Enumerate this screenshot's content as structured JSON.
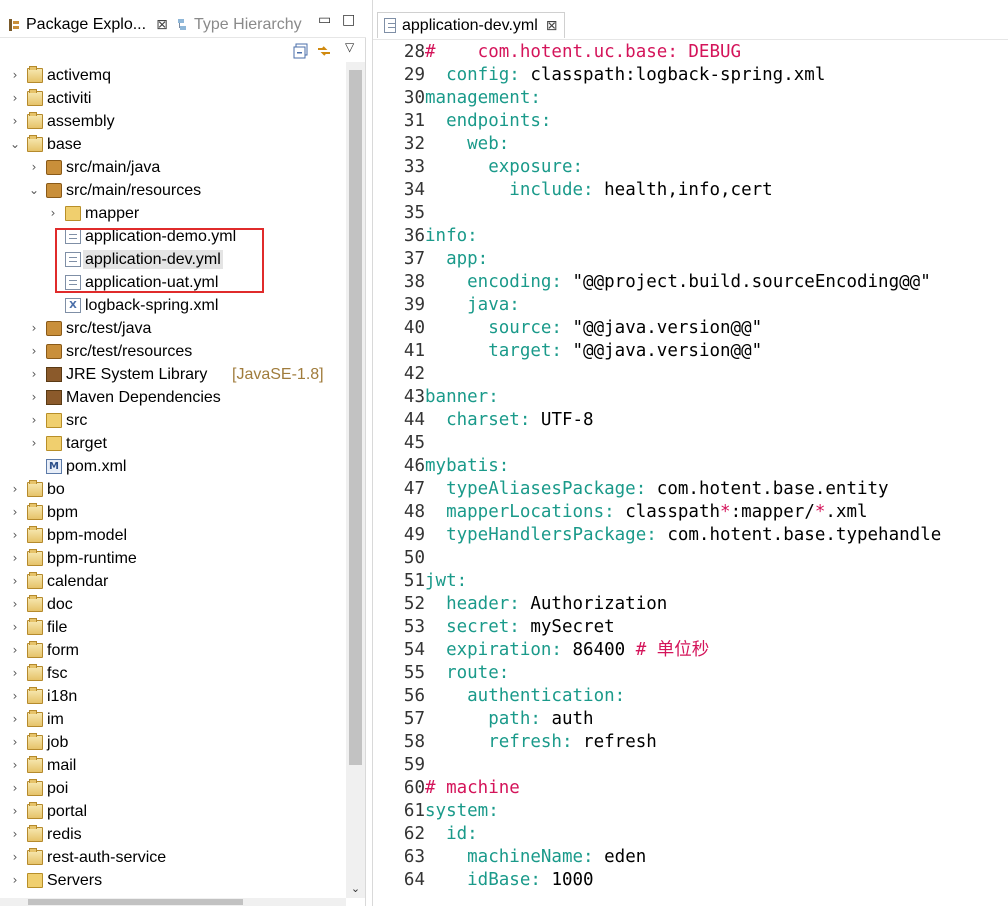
{
  "left_panel": {
    "tabs": [
      {
        "label": "Package Explo...",
        "active": true
      },
      {
        "label": "Type Hierarchy",
        "active": false
      }
    ],
    "close_glyph": "⊠",
    "minimize_glyph": "▭",
    "maximize_glyph": "□",
    "view_menu_glyph": "▽",
    "tree": [
      {
        "label": "activemq",
        "icon": "project-icon",
        "depth": 0,
        "chevron": "›"
      },
      {
        "label": "activiti",
        "icon": "project-icon",
        "depth": 0,
        "chevron": "›"
      },
      {
        "label": "assembly",
        "icon": "project-icon",
        "depth": 0,
        "chevron": "›"
      },
      {
        "label": "base",
        "icon": "project-icon",
        "depth": 0,
        "chevron": "⌄"
      },
      {
        "label": "src/main/java",
        "icon": "package-folder-icon",
        "depth": 1,
        "chevron": "›"
      },
      {
        "label": "src/main/resources",
        "icon": "package-folder-icon",
        "depth": 1,
        "chevron": "⌄"
      },
      {
        "label": "mapper",
        "icon": "folder-icon",
        "depth": 2,
        "chevron": "›"
      },
      {
        "label": "application-demo.yml",
        "icon": "file-icon",
        "depth": 2,
        "chevron": ""
      },
      {
        "label": "application-dev.yml",
        "icon": "file-icon",
        "depth": 2,
        "chevron": "",
        "selected": true
      },
      {
        "label": "application-uat.yml",
        "icon": "file-icon",
        "depth": 2,
        "chevron": ""
      },
      {
        "label": "logback-spring.xml",
        "icon": "xml-file-icon",
        "depth": 2,
        "chevron": ""
      },
      {
        "label": "src/test/java",
        "icon": "package-folder-icon",
        "depth": 1,
        "chevron": "›"
      },
      {
        "label": "src/test/resources",
        "icon": "package-folder-icon",
        "depth": 1,
        "chevron": "›"
      },
      {
        "label": "JRE System Library",
        "decoration": "[JavaSE-1.8]",
        "icon": "library-icon",
        "depth": 1,
        "chevron": "›"
      },
      {
        "label": "Maven Dependencies",
        "icon": "library-icon",
        "depth": 1,
        "chevron": "›"
      },
      {
        "label": "src",
        "icon": "folder-icon",
        "depth": 1,
        "chevron": "›"
      },
      {
        "label": "target",
        "icon": "folder-icon",
        "depth": 1,
        "chevron": "›"
      },
      {
        "label": "pom.xml",
        "icon": "pom-file-icon",
        "depth": 1,
        "chevron": ""
      },
      {
        "label": "bo",
        "icon": "project-icon",
        "depth": 0,
        "chevron": "›"
      },
      {
        "label": "bpm",
        "icon": "project-icon",
        "depth": 0,
        "chevron": "›"
      },
      {
        "label": "bpm-model",
        "icon": "project-icon",
        "depth": 0,
        "chevron": "›"
      },
      {
        "label": "bpm-runtime",
        "icon": "project-icon",
        "depth": 0,
        "chevron": "›"
      },
      {
        "label": "calendar",
        "icon": "project-icon",
        "depth": 0,
        "chevron": "›"
      },
      {
        "label": "doc",
        "icon": "project-icon",
        "depth": 0,
        "chevron": "›"
      },
      {
        "label": "file",
        "icon": "project-icon",
        "depth": 0,
        "chevron": "›"
      },
      {
        "label": "form",
        "icon": "project-icon",
        "depth": 0,
        "chevron": "›"
      },
      {
        "label": "fsc",
        "icon": "project-icon",
        "depth": 0,
        "chevron": "›"
      },
      {
        "label": "i18n",
        "icon": "project-icon",
        "depth": 0,
        "chevron": "›"
      },
      {
        "label": "im",
        "icon": "project-icon",
        "depth": 0,
        "chevron": "›"
      },
      {
        "label": "job",
        "icon": "project-icon",
        "depth": 0,
        "chevron": "›"
      },
      {
        "label": "mail",
        "icon": "project-icon",
        "depth": 0,
        "chevron": "›"
      },
      {
        "label": "poi",
        "icon": "project-icon",
        "depth": 0,
        "chevron": "›"
      },
      {
        "label": "portal",
        "icon": "project-icon",
        "depth": 0,
        "chevron": "›"
      },
      {
        "label": "redis",
        "icon": "project-icon",
        "depth": 0,
        "chevron": "›"
      },
      {
        "label": "rest-auth-service",
        "icon": "project-icon",
        "depth": 0,
        "chevron": "›"
      },
      {
        "label": "Servers",
        "icon": "folder-icon",
        "depth": 0,
        "chevron": "›"
      }
    ]
  },
  "editor": {
    "tab": {
      "label": "application-dev.yml",
      "close_glyph": "⊠"
    },
    "lines": [
      {
        "n": "28",
        "segs": [
          {
            "t": "#    com.hotent.uc.base: DEBUG",
            "c": "c"
          }
        ]
      },
      {
        "n": "29",
        "segs": [
          {
            "t": "  config: ",
            "c": "k"
          },
          {
            "t": "classpath:logback-spring.xml",
            "c": "v"
          }
        ]
      },
      {
        "n": "30",
        "segs": [
          {
            "t": "management:",
            "c": "k"
          }
        ]
      },
      {
        "n": "31",
        "segs": [
          {
            "t": "  endpoints:",
            "c": "k"
          }
        ]
      },
      {
        "n": "32",
        "segs": [
          {
            "t": "    web:",
            "c": "k"
          }
        ]
      },
      {
        "n": "33",
        "segs": [
          {
            "t": "      exposure:",
            "c": "k"
          }
        ]
      },
      {
        "n": "34",
        "segs": [
          {
            "t": "        include: ",
            "c": "k"
          },
          {
            "t": "health,info,cert",
            "c": "v"
          }
        ]
      },
      {
        "n": "35",
        "segs": []
      },
      {
        "n": "36",
        "segs": [
          {
            "t": "info:",
            "c": "k"
          }
        ]
      },
      {
        "n": "37",
        "segs": [
          {
            "t": "  app:",
            "c": "k"
          }
        ]
      },
      {
        "n": "38",
        "segs": [
          {
            "t": "    encoding: ",
            "c": "k"
          },
          {
            "t": "\"@@project.build.sourceEncoding@@\"",
            "c": "v"
          }
        ]
      },
      {
        "n": "39",
        "segs": [
          {
            "t": "    java:",
            "c": "k"
          }
        ]
      },
      {
        "n": "40",
        "segs": [
          {
            "t": "      source: ",
            "c": "k"
          },
          {
            "t": "\"@@java.version@@\"",
            "c": "v"
          }
        ]
      },
      {
        "n": "41",
        "segs": [
          {
            "t": "      target: ",
            "c": "k"
          },
          {
            "t": "\"@@java.version@@\"",
            "c": "v"
          }
        ]
      },
      {
        "n": "42",
        "segs": []
      },
      {
        "n": "43",
        "segs": [
          {
            "t": "banner:",
            "c": "k"
          }
        ]
      },
      {
        "n": "44",
        "segs": [
          {
            "t": "  charset: ",
            "c": "k"
          },
          {
            "t": "UTF-8",
            "c": "v"
          }
        ]
      },
      {
        "n": "45",
        "segs": []
      },
      {
        "n": "46",
        "segs": [
          {
            "t": "mybatis:",
            "c": "k"
          }
        ]
      },
      {
        "n": "47",
        "segs": [
          {
            "t": "  typeAliasesPackage: ",
            "c": "k"
          },
          {
            "t": "com.hotent.base.entity",
            "c": "v"
          }
        ]
      },
      {
        "n": "48",
        "segs": [
          {
            "t": "  mapperLocations: ",
            "c": "k"
          },
          {
            "t": "classpath",
            "c": "v"
          },
          {
            "t": "*",
            "c": "p"
          },
          {
            "t": ":mapper/",
            "c": "v"
          },
          {
            "t": "*",
            "c": "p"
          },
          {
            "t": ".xml",
            "c": "v"
          }
        ]
      },
      {
        "n": "49",
        "segs": [
          {
            "t": "  typeHandlersPackage: ",
            "c": "k"
          },
          {
            "t": "com.hotent.base.typehandle",
            "c": "v"
          }
        ]
      },
      {
        "n": "50",
        "segs": []
      },
      {
        "n": "51",
        "segs": [
          {
            "t": "jwt:",
            "c": "k"
          }
        ]
      },
      {
        "n": "52",
        "segs": [
          {
            "t": "  header: ",
            "c": "k"
          },
          {
            "t": "Authorization",
            "c": "v"
          }
        ]
      },
      {
        "n": "53",
        "segs": [
          {
            "t": "  secret: ",
            "c": "k"
          },
          {
            "t": "mySecret",
            "c": "v"
          }
        ]
      },
      {
        "n": "54",
        "segs": [
          {
            "t": "  expiration: ",
            "c": "k"
          },
          {
            "t": "86400 ",
            "c": "v"
          },
          {
            "t": "# 单位秒",
            "c": "c"
          }
        ]
      },
      {
        "n": "55",
        "segs": [
          {
            "t": "  route:",
            "c": "k"
          }
        ]
      },
      {
        "n": "56",
        "segs": [
          {
            "t": "    authentication:",
            "c": "k"
          }
        ]
      },
      {
        "n": "57",
        "segs": [
          {
            "t": "      path: ",
            "c": "k"
          },
          {
            "t": "auth",
            "c": "v"
          }
        ]
      },
      {
        "n": "58",
        "segs": [
          {
            "t": "      refresh: ",
            "c": "k"
          },
          {
            "t": "refresh",
            "c": "v"
          }
        ]
      },
      {
        "n": "59",
        "segs": []
      },
      {
        "n": "60",
        "segs": [
          {
            "t": "# machine",
            "c": "c"
          }
        ]
      },
      {
        "n": "61",
        "segs": [
          {
            "t": "system:",
            "c": "k"
          }
        ]
      },
      {
        "n": "62",
        "segs": [
          {
            "t": "  id:",
            "c": "k"
          }
        ]
      },
      {
        "n": "63",
        "segs": [
          {
            "t": "    machineName: ",
            "c": "k"
          },
          {
            "t": "eden",
            "c": "v"
          }
        ]
      },
      {
        "n": "64",
        "segs": [
          {
            "t": "    idBase: ",
            "c": "k"
          },
          {
            "t": "1000",
            "c": "v"
          }
        ]
      }
    ]
  },
  "colors": {
    "key": "#1a9a8a",
    "value": "#000000",
    "comment": "#d4145a",
    "highlight_box": "#e02b2b",
    "selection_bg": "#e4e4e4"
  }
}
